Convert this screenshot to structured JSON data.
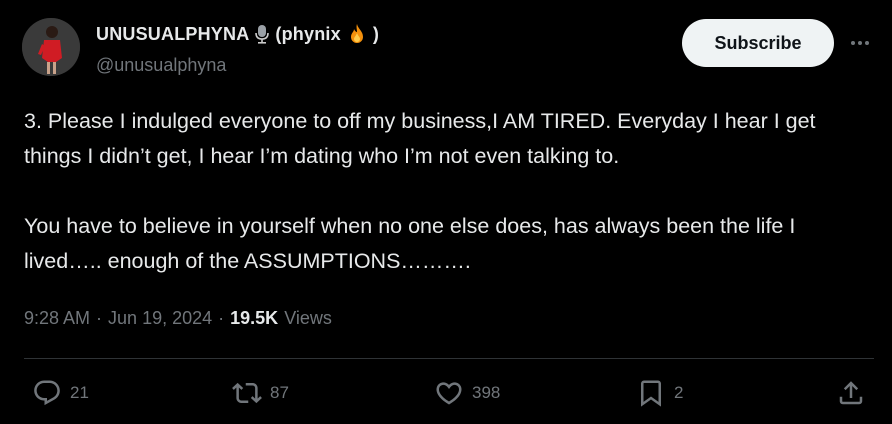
{
  "author": {
    "display_name": "UNUSUALPHYNA",
    "name_suffix": "(phynix",
    "name_close": ")",
    "handle": "@unusualphyna",
    "avatar_icon": "avatar-photo",
    "emoji_1": "microphone-icon",
    "emoji_2": "fire-icon"
  },
  "header": {
    "subscribe_label": "Subscribe",
    "more_icon": "more-icon"
  },
  "tweet": {
    "text": "3. Please I indulged everyone to off my business,I AM TIRED. Everyday I hear I get things I didn’t get, I hear I’m dating who I’m not even talking to.\n\nYou have to believe in yourself when no one else does, has always been the life I lived….. enough of the ASSUMPTIONS……….",
    "time": "9:28 AM",
    "separator": "·",
    "date": "Jun 19, 2024",
    "views_count": "19.5K",
    "views_label": "Views"
  },
  "actions": {
    "reply_count": "21",
    "retweet_count": "87",
    "like_count": "398",
    "bookmark_count": "2"
  },
  "colors": {
    "background": "#000000",
    "text": "#e7e9ea",
    "muted": "#71767b",
    "button_bg": "#eff3f4"
  }
}
